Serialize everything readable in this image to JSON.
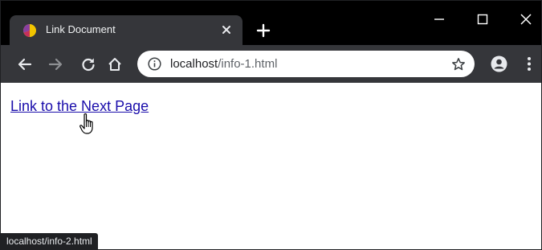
{
  "tab": {
    "title": "Link Document"
  },
  "toolbar": {
    "url_host": "localhost",
    "url_path": "/info-1.html"
  },
  "page": {
    "link_text": "Link to the Next Page"
  },
  "status_bar": {
    "text": "localhost/info-2.html"
  },
  "icons": {
    "favicon": "pie-favicon-icon",
    "tab_close": "close-icon",
    "new_tab": "plus-icon",
    "back": "arrow-left-icon",
    "forward": "arrow-right-icon",
    "reload": "reload-icon",
    "home": "home-icon",
    "site_info": "info-icon",
    "bookmark": "star-icon",
    "profile": "account-icon",
    "menu": "kebab-menu-icon",
    "pointer": "hand-pointer-cursor-icon"
  },
  "colors": {
    "titlebar": "#000000",
    "toolbar": "#35363a",
    "link": "#1a0dab",
    "status_bg": "#202124"
  }
}
